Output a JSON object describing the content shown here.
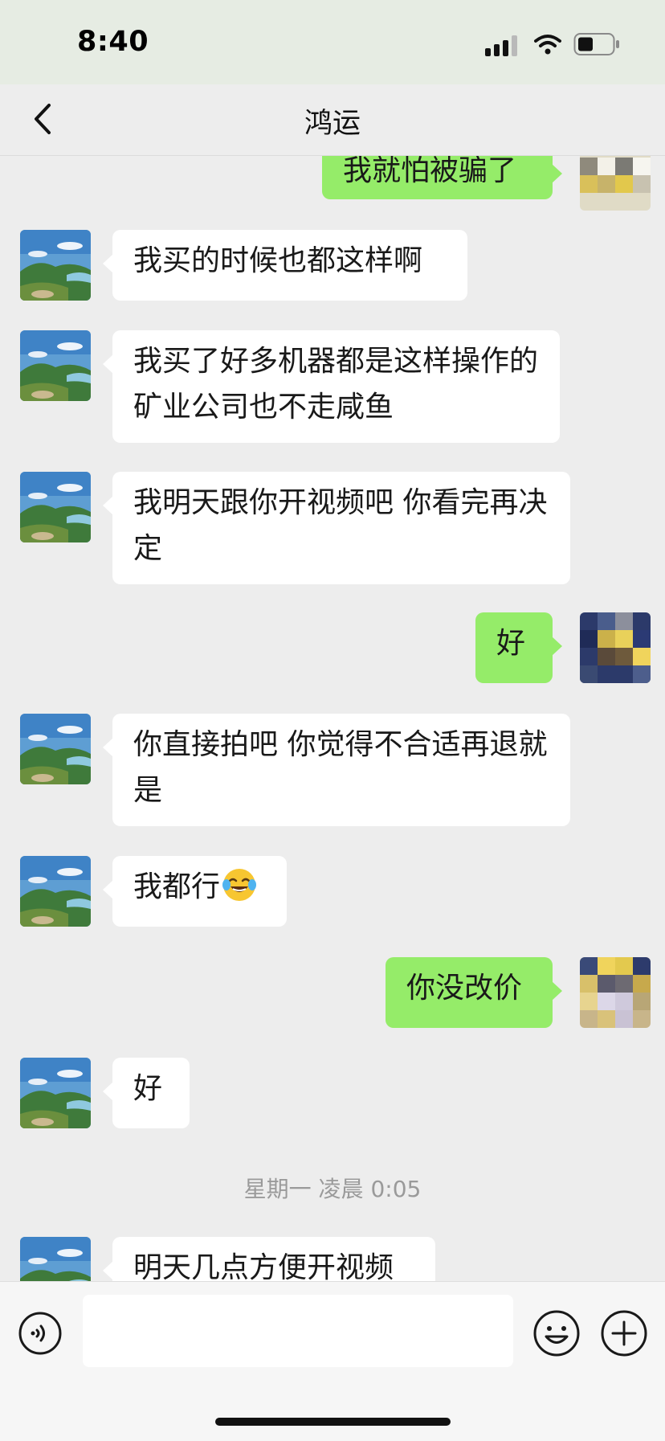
{
  "status_bar": {
    "time": "8:40"
  },
  "header": {
    "title": "鸿运"
  },
  "messages": [
    {
      "side": "out",
      "text": "我就怕被骗了"
    },
    {
      "side": "in",
      "text": "我买的时候也都这样啊"
    },
    {
      "side": "in",
      "text": "我买了好多机器都是这样操作的 矿业公司也不走咸鱼"
    },
    {
      "side": "in",
      "text": "我明天跟你开视频吧 你看完再决定"
    },
    {
      "side": "out",
      "text": "好"
    },
    {
      "side": "in",
      "text": "你直接拍吧 你觉得不合适再退就是"
    },
    {
      "side": "in",
      "text": "我都行",
      "emoji": "face-with-tears-of-joy"
    },
    {
      "side": "out",
      "text": "你没改价"
    },
    {
      "side": "in",
      "text": "好"
    },
    {
      "side": "in",
      "text": "明天几点方便开视频"
    }
  ],
  "timestamp": "星期一 凌晨 0:05",
  "input_bar": {
    "value": "",
    "placeholder": ""
  },
  "colors": {
    "incoming_bubble": "#ffffff",
    "outgoing_bubble": "#95ec69",
    "chat_background": "#ededed"
  },
  "icons": [
    "back-arrow-icon",
    "voice-icon",
    "emoji-icon",
    "plus-icon"
  ]
}
